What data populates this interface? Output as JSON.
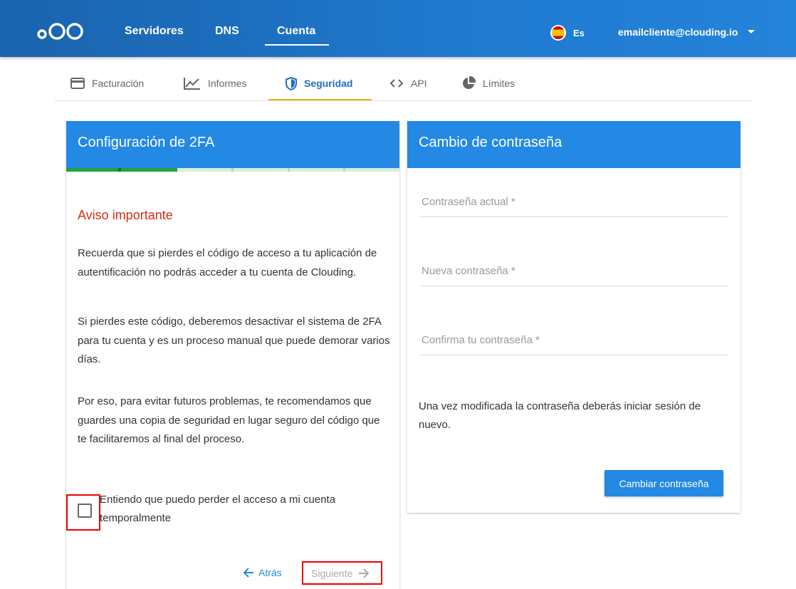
{
  "topbar": {
    "nav": [
      "Servidores",
      "DNS",
      "Cuenta"
    ],
    "active_nav": "Cuenta",
    "language": "Es",
    "user_email": "emailcliente@clouding.io"
  },
  "subtabs": {
    "items": [
      "Facturación",
      "Informes",
      "Seguridad",
      "API",
      "Límites"
    ],
    "active": "Seguridad"
  },
  "twofa": {
    "title": "Configuración de 2FA",
    "progress_steps_completed": 2,
    "progress_steps_total": 6,
    "warning_title": "Aviso importante",
    "paragraphs": [
      "Recuerda que si pierdes el código de acceso a tu aplicación de autentificación no podrás acceder a tu cuenta de Clouding.",
      "Si pierdes este código, deberemos desactivar el sistema de 2FA para tu cuenta y es un proceso manual que puede demorar varios días.",
      "Por eso, para evitar futuros problemas, te recomendamos que guardes una copia de seguridad en lugar seguro del código que te facilitaremos al final del proceso."
    ],
    "checkbox_label": "Entiendo que puedo perder el acceso a mi cuenta temporalmente",
    "checked": false,
    "back_label": "Atrás",
    "next_label": "Siguiente"
  },
  "password": {
    "title": "Cambio de contraseña",
    "current_placeholder": "Contraseña actual *",
    "new_placeholder": "Nueva contraseña *",
    "confirm_placeholder": "Confirma tu contraseña *",
    "note": "Una vez modificada la contraseña deberás iniciar sesión de nuevo.",
    "submit_label": "Cambiar contraseña"
  },
  "colors": {
    "header_blue": "#2389e4",
    "warning_red": "#d32f0f",
    "progress_green": "#21a33b",
    "tab_accent": "#f5a623"
  }
}
